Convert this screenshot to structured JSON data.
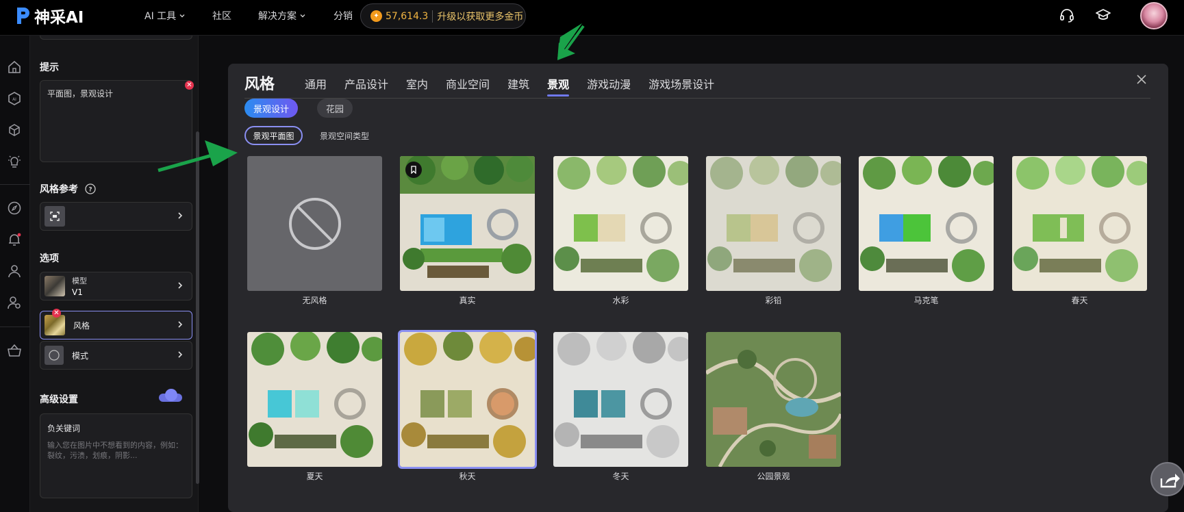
{
  "header": {
    "brand": "神采AI",
    "nav": [
      {
        "label": "AI 工具",
        "dropdown": true
      },
      {
        "label": "社区",
        "dropdown": false
      },
      {
        "label": "解决方案",
        "dropdown": true
      },
      {
        "label": "分销",
        "dropdown": false
      }
    ],
    "coins": "57,614.3",
    "upgrade": "升级以获取更多金币",
    "icons": [
      "headset-icon",
      "graduation-cap-icon"
    ]
  },
  "rail": {
    "icons": [
      "home-icon",
      "ai-icon",
      "cube-icon",
      "lightbulb-icon",
      "compass-icon",
      "bell-icon",
      "user-icon",
      "user-settings-icon",
      "basket-icon"
    ]
  },
  "panel": {
    "prompt_label": "提示",
    "prompt_value": "平面图，景观设计",
    "style_ref_label": "风格参考",
    "options_label": "选项",
    "model_label": "模型",
    "model_value": "V1",
    "style_label": "风格",
    "mode_label": "模式",
    "advanced_label": "高级设置",
    "advanced_on": true,
    "negative_label": "负关键词",
    "negative_placeholder": "输入您在图片中不想看到的内容，例如：裂纹，污渍，划痕，阴影..."
  },
  "modal": {
    "title": "风格",
    "tabs": [
      "通用",
      "产品设计",
      "室内",
      "商业空间",
      "建筑",
      "景观",
      "游戏动漫",
      "游戏场景设计"
    ],
    "active_tab": "景观",
    "pills": [
      "景观设计",
      "花园"
    ],
    "active_pill": "景观设计",
    "subtabs": [
      "景观平面图",
      "景观空间类型"
    ],
    "active_subtab": "景观平面图",
    "styles": [
      {
        "label": "无风格",
        "kind": "none"
      },
      {
        "label": "真实",
        "kind": "real",
        "bookmark": true
      },
      {
        "label": "水彩",
        "kind": "watercolor"
      },
      {
        "label": "彩铅",
        "kind": "pencil"
      },
      {
        "label": "马克笔",
        "kind": "marker"
      },
      {
        "label": "春天",
        "kind": "spring"
      },
      {
        "label": "夏天",
        "kind": "summer"
      },
      {
        "label": "秋天",
        "kind": "autumn",
        "selected": true
      },
      {
        "label": "冬天",
        "kind": "winter"
      },
      {
        "label": "公园景观",
        "kind": "park"
      }
    ]
  }
}
